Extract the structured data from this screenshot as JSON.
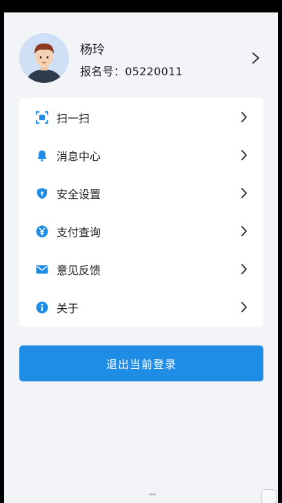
{
  "profile": {
    "name": "杨玲",
    "reg_label": "报名号：",
    "reg_number": "05220011"
  },
  "menu": {
    "items": [
      {
        "label": "扫一扫",
        "icon": "scan-icon"
      },
      {
        "label": "消息中心",
        "icon": "bell-icon"
      },
      {
        "label": "安全设置",
        "icon": "shield-icon"
      },
      {
        "label": "支付查询",
        "icon": "yuan-icon"
      },
      {
        "label": "意见反馈",
        "icon": "mail-icon"
      },
      {
        "label": "关于",
        "icon": "info-icon"
      }
    ]
  },
  "logout": {
    "label": "退出当前登录"
  },
  "colors": {
    "accent": "#1f8ce6",
    "background": "#f3f4f8",
    "card": "#ffffff",
    "text": "#1f1f1f"
  }
}
